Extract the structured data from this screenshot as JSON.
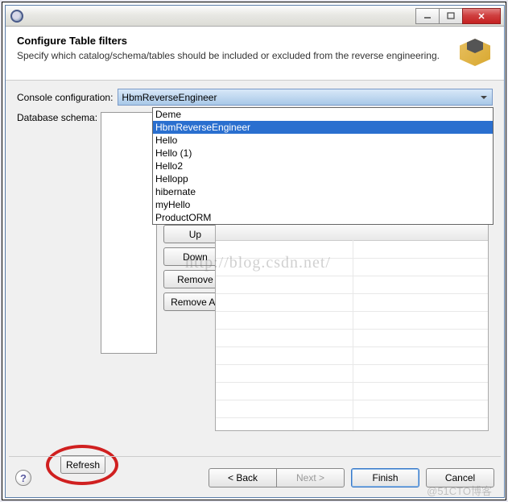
{
  "titlebar": {
    "hidden_title": ""
  },
  "banner": {
    "heading": "Configure Table filters",
    "description": "Specify which catalog/schema/tables should be included or excluded from the reverse engineering."
  },
  "labels": {
    "console_config": "Console configuration:",
    "database_schema": "Database schema:"
  },
  "console_combo": {
    "selected": "HbmReverseEngineer"
  },
  "dropdown_options": [
    {
      "label": "Deme",
      "highlighted": false
    },
    {
      "label": "HbmReverseEngineer",
      "highlighted": true
    },
    {
      "label": "Hello",
      "highlighted": false
    },
    {
      "label": "Hello (1)",
      "highlighted": false
    },
    {
      "label": "Hello2",
      "highlighted": false
    },
    {
      "label": "Hellopp",
      "highlighted": false
    },
    {
      "label": "hibernate",
      "highlighted": false
    },
    {
      "label": "myHello",
      "highlighted": false
    },
    {
      "label": "ProductORM",
      "highlighted": false
    }
  ],
  "side_buttons": {
    "up": "Up",
    "down": "Down",
    "remove": "Remove",
    "remove_all": "Remove All"
  },
  "refresh_button": "Refresh",
  "nav": {
    "back": "< Back",
    "next": "Next >",
    "finish": "Finish",
    "cancel": "Cancel"
  },
  "watermark": "http://blog.csdn.net/",
  "branding": "@51CTO博客"
}
